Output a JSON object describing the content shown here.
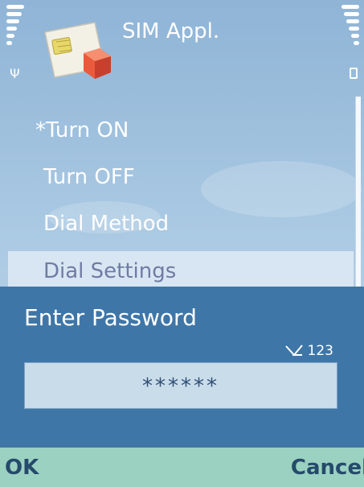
{
  "header": {
    "title": "SIM Appl.",
    "app_icon": "sim-card-icon",
    "signal_icon": "antenna-icon",
    "battery_icon": "battery-icon"
  },
  "menu": {
    "items": [
      "*Turn ON",
      "Turn OFF",
      "Dial Method",
      "Dial Settings"
    ],
    "selected": "Dial Settings"
  },
  "dialog": {
    "title": "Enter Password",
    "input_mode": "123",
    "value": "******"
  },
  "softkeys": {
    "left": "OK",
    "right": "Cancel"
  },
  "colors": {
    "dialog": "#3f76a8",
    "softkey_bar": "#9bd1c0",
    "selected_item": "#d8e6f3"
  }
}
